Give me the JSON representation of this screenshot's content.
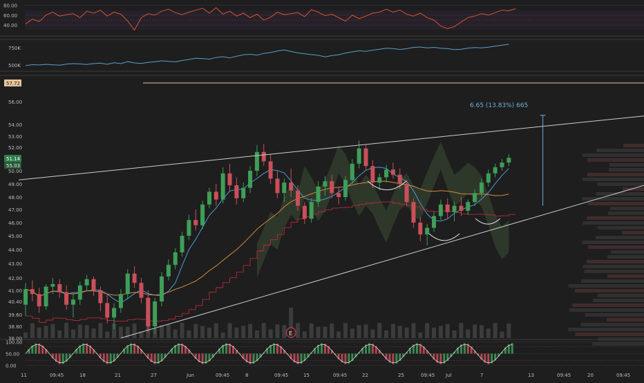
{
  "chart_data": {
    "type": "candlestick",
    "colors": {
      "background": "#1e1e1e",
      "up": "#3f9e58",
      "down": "#c9505a",
      "rsi": "#d4552d",
      "volume_line": "#5aa0c8",
      "trendline": "#cfcfcf",
      "ma_fast": "#4e9ad6",
      "ma_slow": "#d28b3a",
      "supertrend": "#b8283a",
      "cloud": "#3d4f34",
      "measure": "#6fb0d8",
      "level_line": "#e8c49a"
    },
    "rsi_panel": {
      "tick_labels": [
        "80.00",
        "60.00",
        "40.00"
      ],
      "ylim": [
        18,
        85
      ],
      "values": [
        42,
        52,
        47,
        60,
        66,
        58,
        61,
        63,
        55,
        68,
        64,
        70,
        58,
        66,
        62,
        48,
        30,
        55,
        63,
        60,
        68,
        72,
        65,
        61,
        66,
        70,
        74,
        64,
        75,
        62,
        68,
        58,
        64,
        55,
        62,
        50,
        56,
        66,
        61,
        63,
        65,
        57,
        71,
        66,
        59,
        62,
        55,
        48,
        60,
        53,
        58,
        64,
        66,
        72,
        66,
        70,
        62,
        58,
        64,
        55,
        50,
        38,
        33,
        37,
        46,
        55,
        58,
        63,
        60,
        65,
        70,
        69,
        73
      ]
    },
    "volume_ma_panel": {
      "tick_labels": [
        "750K",
        "500K"
      ],
      "ylim": [
        420000,
        860000
      ],
      "values": [
        490000,
        505000,
        500000,
        510000,
        503000,
        498000,
        512000,
        520000,
        515000,
        508000,
        520000,
        528000,
        510000,
        532000,
        520000,
        548000,
        530000,
        522000,
        538000,
        546000,
        560000,
        552000,
        545000,
        565000,
        580000,
        598000,
        592000,
        585000,
        608000,
        620000,
        602000,
        626000,
        648000,
        655000,
        642000,
        668000,
        680000,
        702000,
        718000,
        696000,
        675000,
        662000,
        650000,
        640000,
        618000,
        636000,
        648000,
        672000,
        690000,
        705000,
        698000,
        715000,
        728000,
        742000,
        738000,
        724000,
        736000,
        754000,
        760000,
        748000,
        755000,
        742000,
        736000,
        722000,
        728000,
        744000,
        752000,
        748000,
        758000,
        772000,
        786000,
        800000
      ]
    },
    "price_panel": {
      "tick_labels": [
        "56.00",
        "54.00",
        "53.00",
        "52.00",
        "50.00",
        "49.00",
        "48.00",
        "47.00",
        "46.00",
        "45.00",
        "44.00",
        "43.00",
        "42.00",
        "41.00",
        "40.40",
        "39.60",
        "38.80",
        "38.00"
      ],
      "price_badges": {
        "level": "57.72",
        "last": "51.14",
        "prev": "55.03"
      },
      "level_line": 57.72,
      "ohlc": [
        [
          40.2,
          41.6,
          39.5,
          41.1
        ],
        [
          41.1,
          41.8,
          40.4,
          40.8
        ],
        [
          40.8,
          41.2,
          39.7,
          40.1
        ],
        [
          40.1,
          41.5,
          39.9,
          41.3
        ],
        [
          41.3,
          42.0,
          40.8,
          41.5
        ],
        [
          41.5,
          41.9,
          40.6,
          40.9
        ],
        [
          40.9,
          41.4,
          39.9,
          40.2
        ],
        [
          40.2,
          40.9,
          39.4,
          40.5
        ],
        [
          40.5,
          41.7,
          40.2,
          41.4
        ],
        [
          41.4,
          42.2,
          41.0,
          41.9
        ],
        [
          41.9,
          42.1,
          40.7,
          41.0
        ],
        [
          41.0,
          41.3,
          39.8,
          40.3
        ],
        [
          40.3,
          40.8,
          39.0,
          39.4
        ],
        [
          39.4,
          40.3,
          38.6,
          40.0
        ],
        [
          40.0,
          41.1,
          39.7,
          40.8
        ],
        [
          40.8,
          42.6,
          40.5,
          42.3
        ],
        [
          42.3,
          42.8,
          41.2,
          41.6
        ],
        [
          41.6,
          42.0,
          40.3,
          40.6
        ],
        [
          40.6,
          41.0,
          38.4,
          38.8
        ],
        [
          38.8,
          40.6,
          38.3,
          40.4
        ],
        [
          40.4,
          42.4,
          40.1,
          42.1
        ],
        [
          42.1,
          43.3,
          41.8,
          42.9
        ],
        [
          42.9,
          44.1,
          42.6,
          43.8
        ],
        [
          43.8,
          45.3,
          43.5,
          45.0
        ],
        [
          45.0,
          46.6,
          44.7,
          46.2
        ],
        [
          46.2,
          47.0,
          45.4,
          45.8
        ],
        [
          45.8,
          47.7,
          45.5,
          47.4
        ],
        [
          47.4,
          48.7,
          47.1,
          48.4
        ],
        [
          48.4,
          49.0,
          47.3,
          47.8
        ],
        [
          47.8,
          50.3,
          47.5,
          49.8
        ],
        [
          49.8,
          50.6,
          48.4,
          48.9
        ],
        [
          48.9,
          49.5,
          47.4,
          47.9
        ],
        [
          47.9,
          49.1,
          47.6,
          48.7
        ],
        [
          48.7,
          50.4,
          48.3,
          50.0
        ],
        [
          50.0,
          52.2,
          49.6,
          51.6
        ],
        [
          51.6,
          52.3,
          50.4,
          50.8
        ],
        [
          50.8,
          51.4,
          49.0,
          49.4
        ],
        [
          49.4,
          50.0,
          47.9,
          48.3
        ],
        [
          48.3,
          49.4,
          47.6,
          49.1
        ],
        [
          49.1,
          50.2,
          48.0,
          48.5
        ],
        [
          48.5,
          48.9,
          46.9,
          47.3
        ],
        [
          47.3,
          47.6,
          45.9,
          46.3
        ],
        [
          46.3,
          47.9,
          46.0,
          47.6
        ],
        [
          47.6,
          49.2,
          47.2,
          48.8
        ],
        [
          48.8,
          49.6,
          48.1,
          49.2
        ],
        [
          49.2,
          49.7,
          47.9,
          48.3
        ],
        [
          48.3,
          48.8,
          47.4,
          48.0
        ],
        [
          48.0,
          49.6,
          47.7,
          49.3
        ],
        [
          49.3,
          51.0,
          49.0,
          50.6
        ],
        [
          50.6,
          52.6,
          50.2,
          51.9
        ],
        [
          51.9,
          52.2,
          50.0,
          50.4
        ],
        [
          50.4,
          50.9,
          48.7,
          49.1
        ],
        [
          49.1,
          49.8,
          48.5,
          49.5
        ],
        [
          49.5,
          50.5,
          49.1,
          50.1
        ],
        [
          50.1,
          50.7,
          49.4,
          49.7
        ],
        [
          49.7,
          50.2,
          48.6,
          49.0
        ],
        [
          49.0,
          49.3,
          47.2,
          47.6
        ],
        [
          47.6,
          47.9,
          45.6,
          46.0
        ],
        [
          46.0,
          46.4,
          44.6,
          45.1
        ],
        [
          45.1,
          45.9,
          44.3,
          45.6
        ],
        [
          45.6,
          46.8,
          45.3,
          46.5
        ],
        [
          46.5,
          47.8,
          46.2,
          47.4
        ],
        [
          47.4,
          47.9,
          46.3,
          46.8
        ],
        [
          46.8,
          47.6,
          46.1,
          47.3
        ],
        [
          47.3,
          48.0,
          46.5,
          46.9
        ],
        [
          46.9,
          47.8,
          46.6,
          47.6
        ],
        [
          47.6,
          48.6,
          47.3,
          48.3
        ],
        [
          48.3,
          49.4,
          48.0,
          49.1
        ],
        [
          49.1,
          50.1,
          48.8,
          49.8
        ],
        [
          49.8,
          50.6,
          49.5,
          50.3
        ],
        [
          50.3,
          51.0,
          50.0,
          50.7
        ],
        [
          50.7,
          51.4,
          50.4,
          51.1
        ]
      ]
    },
    "trend_channel": {
      "upper": {
        "from": [
          -1,
          49.3
        ],
        "to": [
          100,
          56.7
        ]
      },
      "lower": {
        "from": [
          14,
          38.0
        ],
        "to": [
          100,
          50.3
        ]
      }
    },
    "measure": {
      "label": "6.65 (13.83%) 665",
      "bar": 76,
      "from": 47.3,
      "to": 54.8
    },
    "earnings_marker": {
      "label": "E",
      "bar": 39
    },
    "stoch_panel": {
      "tick_labels": [
        "100.00",
        "50.00",
        "0.00"
      ],
      "ylim": [
        -5,
        105
      ]
    },
    "x_ticks": [
      "11",
      "09:45",
      "18",
      "21",
      "27",
      "Jun",
      "09:45",
      "8",
      "09:45",
      "15",
      "09:45",
      "22",
      "25",
      "09:45",
      "Jul",
      "7",
      "13",
      "09:45",
      "20",
      "09:45"
    ]
  }
}
